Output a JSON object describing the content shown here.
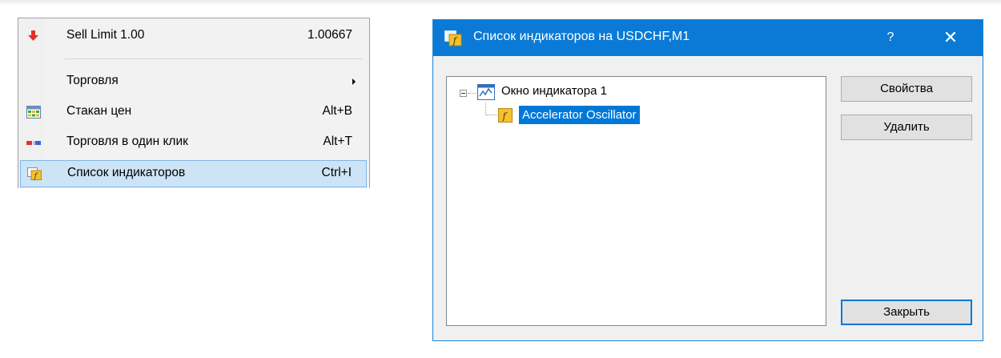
{
  "menu": {
    "items": [
      {
        "label": "Sell Limit 1.00",
        "shortcut": "1.00667",
        "icon": "sell-limit-arrow-icon"
      },
      {
        "label": "Торговля",
        "shortcut": "",
        "icon": "",
        "submenu": true
      },
      {
        "label": "Стакан цен",
        "shortcut": "Alt+B",
        "icon": "depth-of-market-icon"
      },
      {
        "label": "Торговля в один клик",
        "shortcut": "Alt+T",
        "icon": "one-click-trading-icon"
      },
      {
        "label": "Список индикаторов",
        "shortcut": "Ctrl+I",
        "icon": "indicators-list-icon",
        "selected": true
      }
    ]
  },
  "dialog": {
    "title": "Список индикаторов на USDCHF,M1",
    "help": "?",
    "close": "✕",
    "tree": {
      "root": "Окно индикатора 1",
      "child": "Accelerator Oscillator"
    },
    "buttons": {
      "properties": "Свойства",
      "delete": "Удалить",
      "close": "Закрыть"
    }
  },
  "colors": {
    "titlebar": "#0a7ad6",
    "selection": "#0078d7",
    "menu_highlight": "#cde4f7",
    "sell_arrow": "#e0312a"
  }
}
